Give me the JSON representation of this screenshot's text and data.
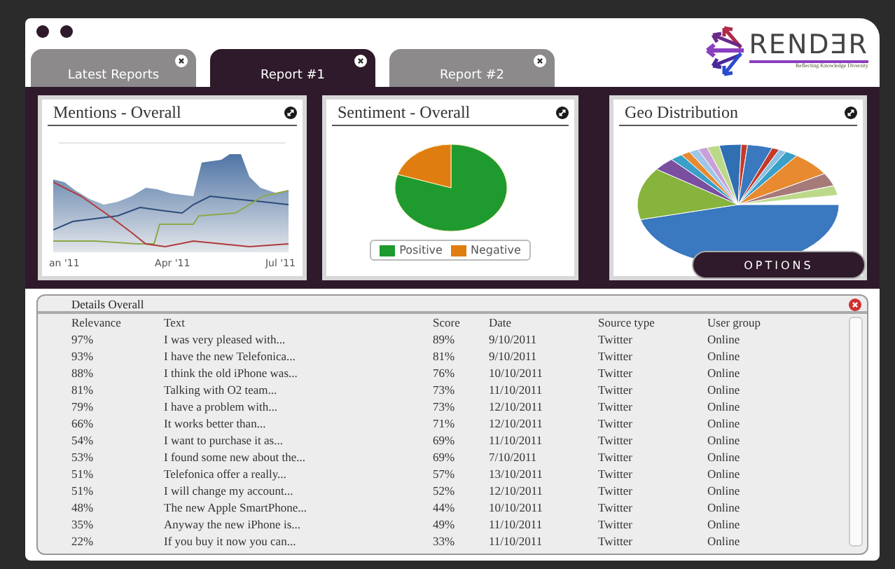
{
  "logo": {
    "name": "RENDƎR",
    "tagline": "Reflecting Knowledge Diversity"
  },
  "tabs": [
    {
      "label": "Latest Reports",
      "selected": false
    },
    {
      "label": "Report #1",
      "selected": true
    },
    {
      "label": "Report #2",
      "selected": false
    }
  ],
  "panels": [
    {
      "kind": "area",
      "title": "Mentions - Overall",
      "x_labels": [
        "an '11",
        "Apr '11",
        "Jul '11"
      ]
    },
    {
      "kind": "pie",
      "title": "Sentiment - Overall",
      "legend": [
        {
          "label": "Positive",
          "color": "#1f9a2e"
        },
        {
          "label": "Negative",
          "color": "#e07d10"
        }
      ]
    },
    {
      "kind": "geo",
      "title": "Geo Distribution"
    }
  ],
  "options_button": "OPTIONS",
  "details": {
    "title": "Details Overall",
    "columns": [
      "Relevance",
      "Text",
      "Score",
      "Date",
      "Source type",
      "User group"
    ],
    "rows": [
      [
        "97%",
        "I was very pleased with...",
        "89%",
        "9/10/2011",
        "Twitter",
        "Online"
      ],
      [
        "93%",
        "I have the new Telefonica...",
        "81%",
        "9/10/2011",
        "Twitter",
        "Online"
      ],
      [
        "88%",
        "I think the old iPhone was...",
        "76%",
        "10/10/2011",
        "Twitter",
        "Online"
      ],
      [
        "81%",
        "Talking with O2 team...",
        "73%",
        "11/10/2011",
        "Twitter",
        "Online"
      ],
      [
        "79%",
        "I have a problem with...",
        "73%",
        "12/10/2011",
        "Twitter",
        "Online"
      ],
      [
        "66%",
        "It works better than...",
        "71%",
        "12/10/2011",
        "Twitter",
        "Online"
      ],
      [
        "54%",
        "I want to purchase it as...",
        "69%",
        "11/10/2011",
        "Twitter",
        "Online"
      ],
      [
        "53%",
        "I found some new about the...",
        "69%",
        "7/10/2011",
        "Twitter",
        "Online"
      ],
      [
        "51%",
        "Telefonica offer a really...",
        "57%",
        "13/10/2011",
        "Twitter",
        "Online"
      ],
      [
        "51%",
        "I will change my account...",
        "52%",
        "12/10/2011",
        "Twitter",
        "Online"
      ],
      [
        "48%",
        "The new Apple SmartPhone...",
        "44%",
        "10/10/2011",
        "Twitter",
        "Online"
      ],
      [
        "35%",
        "Anyway the new iPhone is...",
        "49%",
        "11/10/2011",
        "Twitter",
        "Online"
      ],
      [
        "22%",
        "If you buy it now you can...",
        "33%",
        "11/10/2011",
        "Twitter",
        "Online"
      ]
    ]
  }
}
